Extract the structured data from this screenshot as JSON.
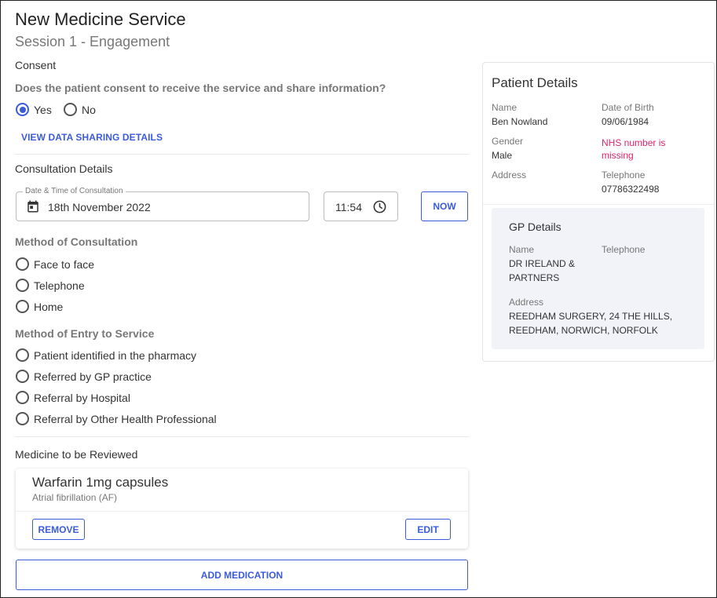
{
  "header": {
    "title": "New Medicine Service",
    "subtitle": "Session 1 - Engagement"
  },
  "consent": {
    "heading": "Consent",
    "question": "Does the patient consent to receive the service and share information?",
    "options": [
      {
        "label": "Yes",
        "selected": true
      },
      {
        "label": "No",
        "selected": false
      }
    ],
    "view_link": "VIEW DATA SHARING DETAILS"
  },
  "consultation": {
    "heading": "Consultation Details",
    "date_label": "Date & Time of Consultation",
    "date_value": "18th November 2022",
    "time_value": "11:54",
    "now_button": "NOW",
    "method_heading": "Method of Consultation",
    "methods": [
      "Face to face",
      "Telephone",
      "Home"
    ],
    "entry_heading": "Method of Entry to Service",
    "entries": [
      "Patient identified in the pharmacy",
      "Referred by GP practice",
      "Referral by Hospital",
      "Referral by Other Health Professional"
    ]
  },
  "medicine": {
    "heading": "Medicine to be Reviewed",
    "name": "Warfarin 1mg capsules",
    "condition": "Atrial fibrillation (AF)",
    "remove_button": "REMOVE",
    "edit_button": "EDIT",
    "add_button": "ADD MEDICATION"
  },
  "patient": {
    "heading": "Patient Details",
    "name_label": "Name",
    "name_value": "Ben Nowland",
    "dob_label": "Date of Birth",
    "dob_value": "09/06/1984",
    "gender_label": "Gender",
    "gender_value": "Male",
    "nhs_warning": "NHS number is missing",
    "address_label": "Address",
    "telephone_label": "Telephone",
    "telephone_value": "07786322498"
  },
  "gp": {
    "heading": "GP Details",
    "name_label": "Name",
    "name_value": "DR IRELAND & PARTNERS",
    "telephone_label": "Telephone",
    "address_label": "Address",
    "address_value": "REEDHAM SURGERY, 24 THE HILLS, REEDHAM, NORWICH, NORFOLK"
  },
  "colors": {
    "accent": "#3b5bdb",
    "warning": "#e0246a",
    "gp_panel_bg": "#f2f3f9"
  }
}
